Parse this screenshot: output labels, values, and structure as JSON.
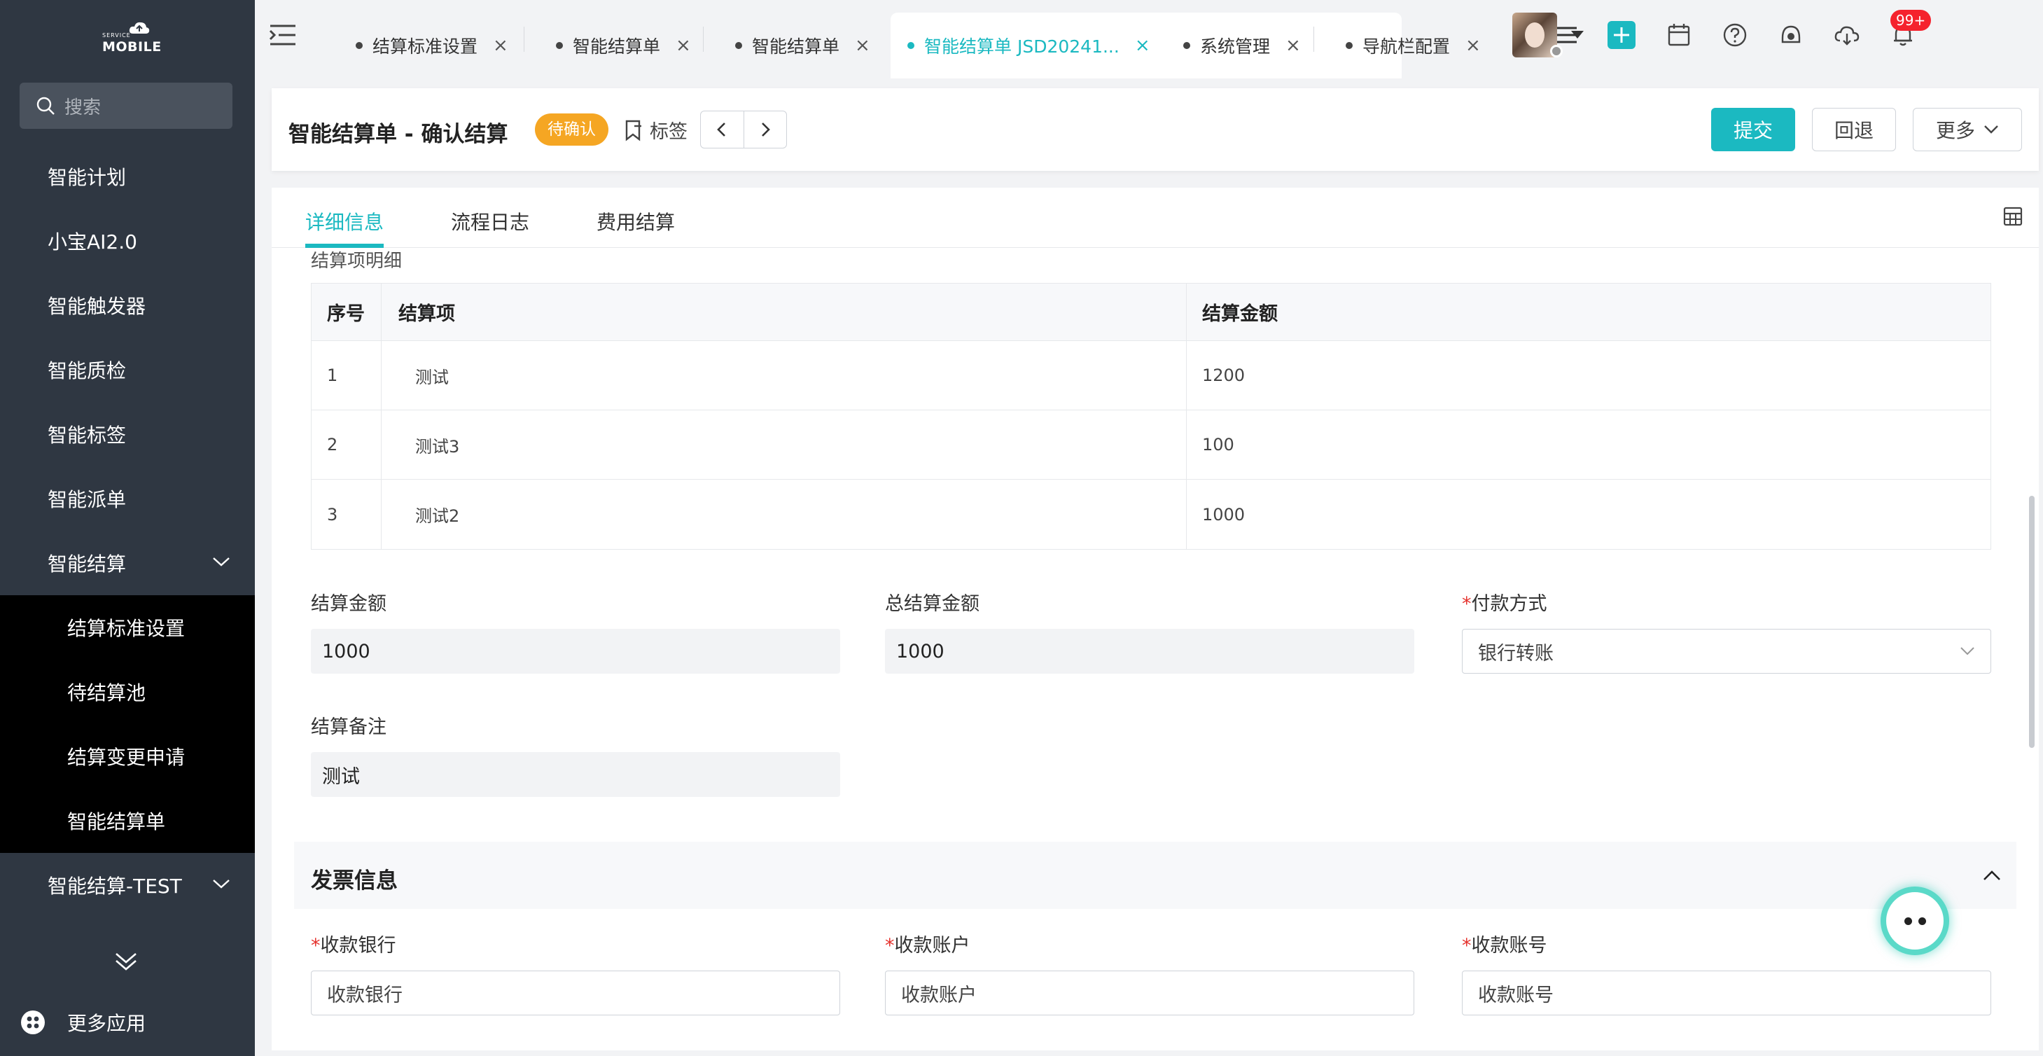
{
  "sidebar": {
    "logo_top": "SERVICE",
    "logo_main": "MOBILE",
    "search_placeholder": "搜索",
    "items": [
      {
        "label": "智能计划"
      },
      {
        "label": "小宝AI2.0"
      },
      {
        "label": "智能触发器"
      },
      {
        "label": "智能质检"
      },
      {
        "label": "智能标签"
      },
      {
        "label": "智能派单"
      },
      {
        "label": "智能结算"
      }
    ],
    "sub_items": [
      {
        "label": "结算标准设置"
      },
      {
        "label": "待结算池"
      },
      {
        "label": "结算变更申请"
      },
      {
        "label": "智能结算单"
      }
    ],
    "after_item": {
      "label": "智能结算-TEST"
    },
    "more_apps": "更多应用"
  },
  "topbar": {
    "tabs": [
      {
        "label": "结算标准设置"
      },
      {
        "label": "智能结算单"
      },
      {
        "label": "智能结算单"
      },
      {
        "label": "智能结算单 JSD20241..."
      },
      {
        "label": "系统管理"
      },
      {
        "label": "导航栏配置"
      }
    ],
    "close_glyph": "×",
    "notification_badge": "99+",
    "accent_color": "#1bb9c1"
  },
  "header": {
    "title": "智能结算单 - 确认结算",
    "status": "待确认",
    "tag_label": "标签",
    "submit_label": "提交",
    "rollback_label": "回退",
    "more_label": "更多"
  },
  "detail_tabs": [
    {
      "label": "详细信息"
    },
    {
      "label": "流程日志"
    },
    {
      "label": "费用结算"
    }
  ],
  "settlement": {
    "section_label": "结算项明细",
    "columns": [
      "序号",
      "结算项",
      "结算金额"
    ],
    "rows": [
      {
        "no": "1",
        "item": "测试",
        "amount": "1200"
      },
      {
        "no": "2",
        "item": "测试3",
        "amount": "100"
      },
      {
        "no": "3",
        "item": "测试2",
        "amount": "1000"
      }
    ],
    "amount_label": "结算金额",
    "amount_value": "1000",
    "total_label": "总结算金额",
    "total_value": "1000",
    "payment_label": "付款方式",
    "payment_value": "银行转账",
    "remark_label": "结算备注",
    "remark_value": "测试"
  },
  "invoice": {
    "title": "发票信息",
    "bank_label": "收款银行",
    "bank_placeholder": "收款银行",
    "account_label": "收款账户",
    "account_placeholder": "收款账户",
    "number_label": "收款账号",
    "number_placeholder": "收款账号"
  }
}
